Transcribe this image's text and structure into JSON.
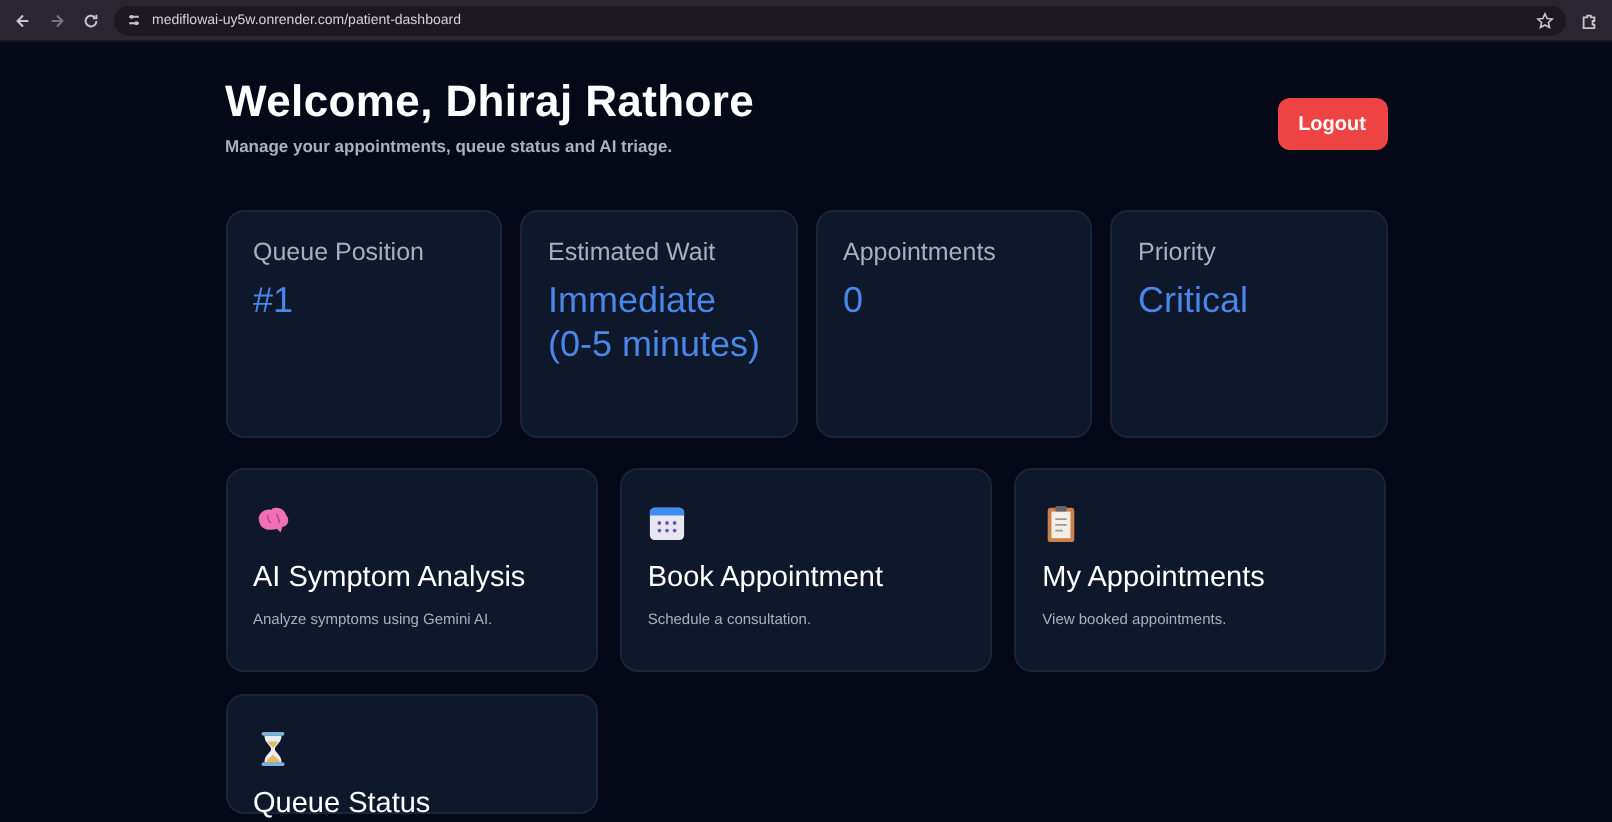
{
  "browser": {
    "url": "mediflowai-uy5w.onrender.com/patient-dashboard"
  },
  "header": {
    "title": "Welcome, Dhiraj Rathore",
    "subtitle": "Manage your appointments, queue status and AI triage.",
    "logout": "Logout"
  },
  "stats": [
    {
      "label": "Queue Position",
      "value": "#1"
    },
    {
      "label": "Estimated Wait",
      "value": "Immediate (0-5 minutes)"
    },
    {
      "label": "Appointments",
      "value": "0"
    },
    {
      "label": "Priority",
      "value": "Critical"
    }
  ],
  "actions": [
    {
      "title": "AI Symptom Analysis",
      "description": "Analyze symptoms using Gemini AI."
    },
    {
      "title": "Book Appointment",
      "description": "Schedule a consultation."
    },
    {
      "title": "My Appointments",
      "description": "View booked appointments."
    },
    {
      "title": "Queue Status"
    }
  ]
}
